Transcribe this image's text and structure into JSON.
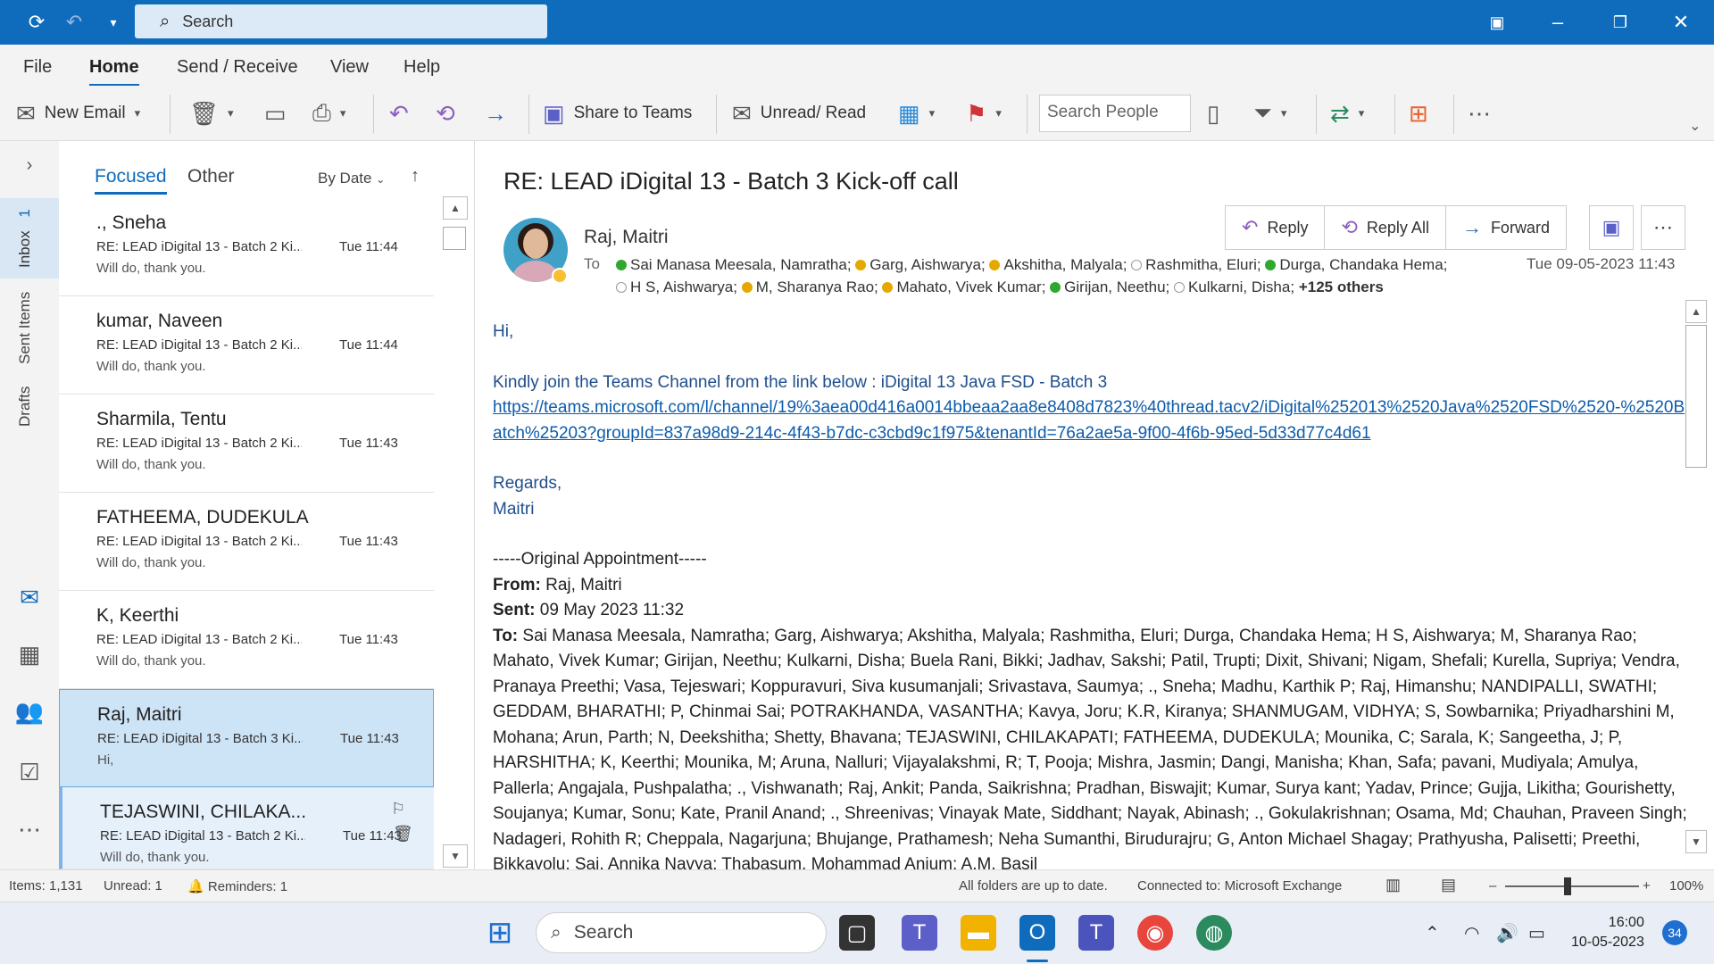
{
  "titlebar": {
    "search_placeholder": "Search"
  },
  "ribbon_tabs": [
    "File",
    "Home",
    "Send / Receive",
    "View",
    "Help"
  ],
  "ribbon": {
    "new_email": "New Email",
    "share_to_teams": "Share to Teams",
    "unread_read": "Unread/ Read",
    "search_people_placeholder": "Search People"
  },
  "rail": {
    "inbox": "Inbox",
    "inbox_count": "1",
    "sent": "Sent Items",
    "drafts": "Drafts"
  },
  "list": {
    "tab_focused": "Focused",
    "tab_other": "Other",
    "sort": "By Date",
    "items": [
      {
        "sender": "., Sneha",
        "subject": "RE: LEAD iDigital 13 - Batch 2 Ki...",
        "time": "Tue 11:44",
        "preview": "Will do, thank you."
      },
      {
        "sender": "kumar, Naveen",
        "subject": "RE: LEAD iDigital 13 - Batch 2 Ki...",
        "time": "Tue 11:44",
        "preview": "Will do, thank you."
      },
      {
        "sender": "Sharmila, Tentu",
        "subject": "RE: LEAD iDigital 13 - Batch 2 Ki...",
        "time": "Tue 11:43",
        "preview": "Will do, thank you."
      },
      {
        "sender": "FATHEEMA, DUDEKULA",
        "subject": "RE: LEAD iDigital 13 - Batch 2 Ki...",
        "time": "Tue 11:43",
        "preview": "Will do, thank you."
      },
      {
        "sender": "K, Keerthi",
        "subject": "RE: LEAD iDigital 13 - Batch 2 Ki...",
        "time": "Tue 11:43",
        "preview": "Will do, thank you."
      },
      {
        "sender": "Raj, Maitri",
        "subject": "RE: LEAD iDigital 13 - Batch 3 Ki...",
        "time": "Tue 11:43",
        "preview": "Hi,"
      },
      {
        "sender": "TEJASWINI, CHILAKA...",
        "subject": "RE: LEAD iDigital 13 - Batch 2 Ki...",
        "time": "Tue 11:43",
        "preview": "Will do, thank you."
      }
    ]
  },
  "reading": {
    "title": "RE: LEAD iDigital 13 - Batch 3 Kick-off call",
    "from": "Raj, Maitri",
    "to_label": "To",
    "sent_date": "Tue 09-05-2023 11:43",
    "actions": {
      "reply": "Reply",
      "reply_all": "Reply All",
      "forward": "Forward"
    },
    "recipients": [
      {
        "name": "Sai Manasa Meesala, Namratha;",
        "status": "g"
      },
      {
        "name": "Garg, Aishwarya;",
        "status": "y"
      },
      {
        "name": "Akshitha, Malyala;",
        "status": "y"
      },
      {
        "name": "Rashmitha, Eluri;",
        "status": "o"
      },
      {
        "name": "Durga, Chandaka Hema;",
        "status": "g"
      },
      {
        "name": "H S, Aishwarya;",
        "status": "o"
      },
      {
        "name": "M, Sharanya Rao;",
        "status": "y"
      },
      {
        "name": "Mahato, Vivek Kumar;",
        "status": "y"
      },
      {
        "name": "Girijan, Neethu;",
        "status": "g"
      },
      {
        "name": "Kulkarni, Disha;",
        "status": "o"
      }
    ],
    "others": "+125 others",
    "body": {
      "greeting": "Hi,",
      "line1": "Kindly join the Teams Channel from the link below : iDigital 13 Java FSD - Batch 3",
      "link": "https://teams.microsoft.com/l/channel/19%3aea00d416a0014bbeaa2aa8e8408d7823%40thread.tacv2/iDigital%252013%2520Java%2520FSD%2520-%2520Batch%25203?groupId=837a98d9-214c-4f43-b7dc-c3cbd9c1f975&tenantId=76a2ae5a-9f00-4f6b-95ed-5d33d77c4d61",
      "regards": "Regards,",
      "sign": "Maitri",
      "orig_header": "-----Original Appointment-----",
      "from_label": "From:",
      "from_value": " Raj, Maitri",
      "sent_label": "Sent:",
      "sent_value": " 09 May 2023 11:32",
      "to_label": "To:",
      "to_value": " Sai Manasa Meesala, Namratha; Garg, Aishwarya; Akshitha, Malyala; Rashmitha, Eluri; Durga, Chandaka Hema; H S, Aishwarya; M, Sharanya Rao; Mahato, Vivek Kumar; Girijan, Neethu; Kulkarni, Disha; Buela Rani, Bikki; Jadhav, Sakshi; Patil, Trupti; Dixit, Shivani; Nigam, Shefali; Kurella, Supriya; Vendra, Pranaya Preethi; Vasa, Tejeswari; Koppuravuri, Siva kusumanjali; Srivastava, Saumya; ., Sneha; Madhu, Karthik P; Raj, Himanshu; NANDIPALLI, SWATHI; GEDDAM, BHARATHI; P, Chinmai Sai; POTRAKHANDA, VASANTHA; Kavya, Joru; K.R, Kiranya; SHANMUGAM, VIDHYA; S, Sowbarnika; Priyadharshini M, Mohana; Arun, Parth; N, Deekshitha; Shetty, Bhavana; TEJASWINI, CHILAKAPATI; FATHEEMA, DUDEKULA; Mounika, C; Sarala, K; Sangeetha, J; P, HARSHITHA; K, Keerthi; Mounika, M; Aruna, Nalluri; Vijayalakshmi, R; T, Pooja; Mishra, Jasmin; Dangi, Manisha; Khan, Safa; pavani, Mudiyala; Amulya, Pallerla; Angajala, Pushpalatha; ., Vishwanath; Raj, Ankit; Panda, Saikrishna; Pradhan, Biswajit; Kumar, Surya kant; Yadav, Prince; Gujja, Likitha; Gourishetty, Soujanya; Kumar, Sonu; Kate, Pranil Anand; ., Shreenivas; Vinayak Mate, Siddhant; Nayak, Abinash; ., Gokulakrishnan; Osama, Md; Chauhan, Praveen Singh; Nadageri, Rohith R; Cheppala, Nagarjuna; Bhujange, Prathamesh; Neha Sumanthi, Birudurajru; G, Anton Michael Shagay; Prathyusha, Palisetti; Preethi, Bikkavolu; Sai, Annika Navya; Thabasum, Mohammad Anjum; A.M, Basil"
    }
  },
  "status": {
    "items": "Items: 1,131",
    "unread": "Unread: 1",
    "reminders": "Reminders: 1",
    "folders": "All folders are up to date.",
    "connected": "Connected to: Microsoft Exchange",
    "zoom": "100%"
  },
  "taskbar": {
    "search": "Search",
    "time": "16:00",
    "date": "10-05-2023",
    "notif": "34"
  },
  "colors": {
    "accent": "#0f6cbd",
    "selected_row": "#cde3f6"
  }
}
